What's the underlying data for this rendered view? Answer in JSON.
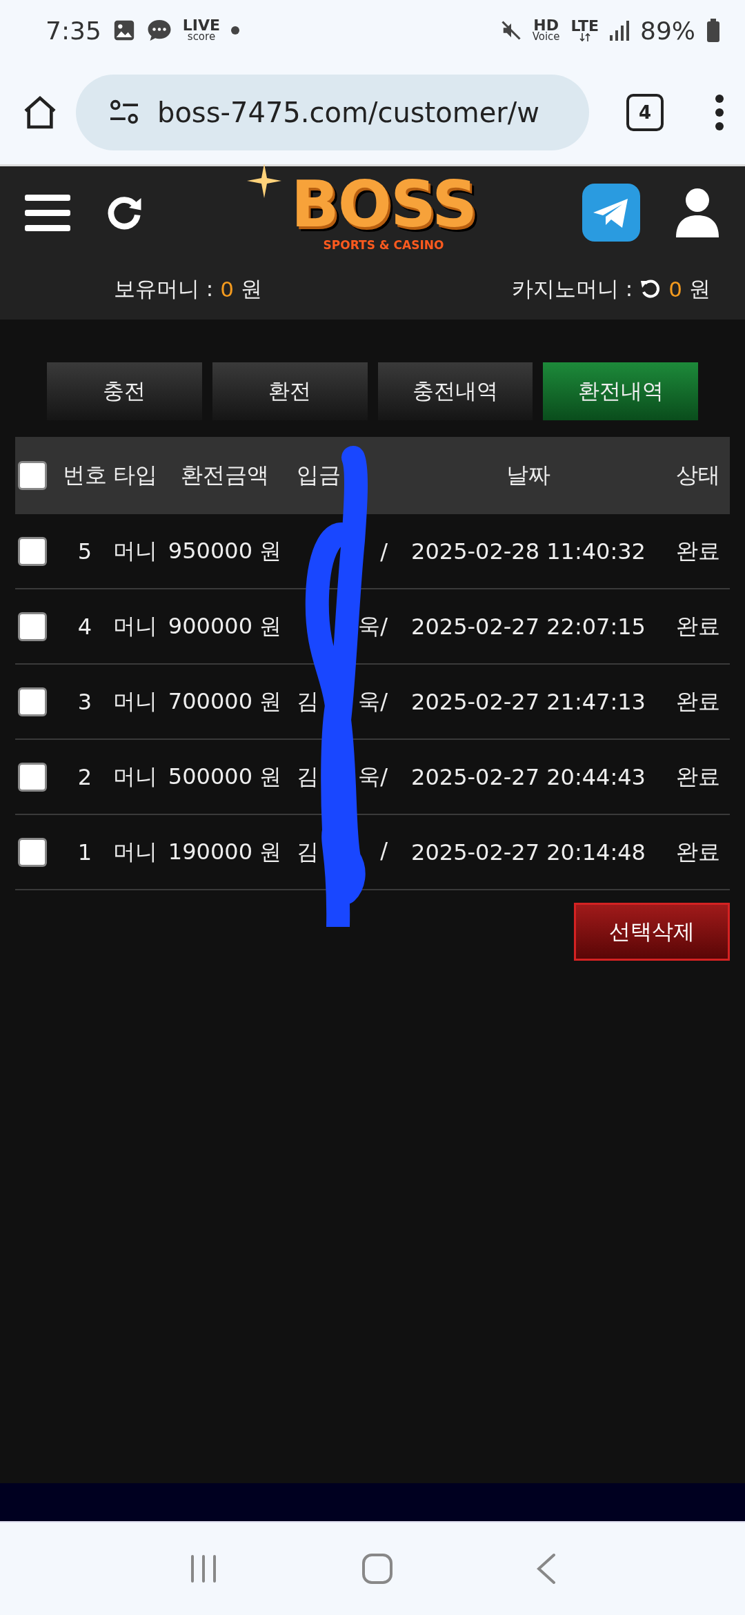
{
  "status_bar": {
    "time": "7:35",
    "live_badge": {
      "top": "LIVE",
      "bottom": "score"
    },
    "hd_badge": {
      "top": "HD",
      "bottom": "Voice"
    },
    "network": "LTE",
    "battery": "89%"
  },
  "browser": {
    "url": "boss-7475.com/customer/w",
    "tab_count": "4"
  },
  "site_header": {
    "logo": {
      "title": "BOSS",
      "subtitle": "SPORTS & CASINO"
    },
    "balances": [
      {
        "kind": "plain",
        "label": "보유머니 :",
        "amount": "0",
        "unit": "원"
      },
      {
        "kind": "refresh",
        "label": "카지노머니 :",
        "amount": "0",
        "unit": "원"
      }
    ]
  },
  "tabs": [
    {
      "label": "충전",
      "selected": false
    },
    {
      "label": "환전",
      "selected": false
    },
    {
      "label": "충전내역",
      "selected": false
    },
    {
      "label": "환전내역",
      "selected": true
    }
  ],
  "table": {
    "select_all_checked": false,
    "columns": [
      {
        "label": "번호"
      },
      {
        "label": "타입"
      },
      {
        "label": "환전금액"
      },
      {
        "label": "입금"
      },
      {
        "label": "날짜"
      },
      {
        "label": "상태"
      }
    ],
    "rows": [
      {
        "checked": false,
        "number": "5",
        "type": "머니",
        "amount": "950000 원",
        "depositor_right": "/",
        "date": "2025-02-28 11:40:32",
        "status": "완료"
      },
      {
        "checked": false,
        "number": "4",
        "type": "머니",
        "amount": "900000 원",
        "depositor_right": "욱/",
        "date": "2025-02-27 22:07:15",
        "status": "완료"
      },
      {
        "checked": false,
        "number": "3",
        "type": "머니",
        "amount": "700000 원",
        "depositor_left": "김",
        "depositor_right": "욱/",
        "date": "2025-02-27 21:47:13",
        "status": "완료"
      },
      {
        "checked": false,
        "number": "2",
        "type": "머니",
        "amount": "500000 원",
        "depositor_left": "김",
        "depositor_right": "욱/",
        "date": "2025-02-27 20:44:43",
        "status": "완료"
      },
      {
        "checked": false,
        "number": "1",
        "type": "머니",
        "amount": "190000 원",
        "depositor_left": "김",
        "depositor_right": "/",
        "date": "2025-02-27 20:14:48",
        "status": "완료"
      }
    ]
  },
  "delete_button": "선택삭제"
}
